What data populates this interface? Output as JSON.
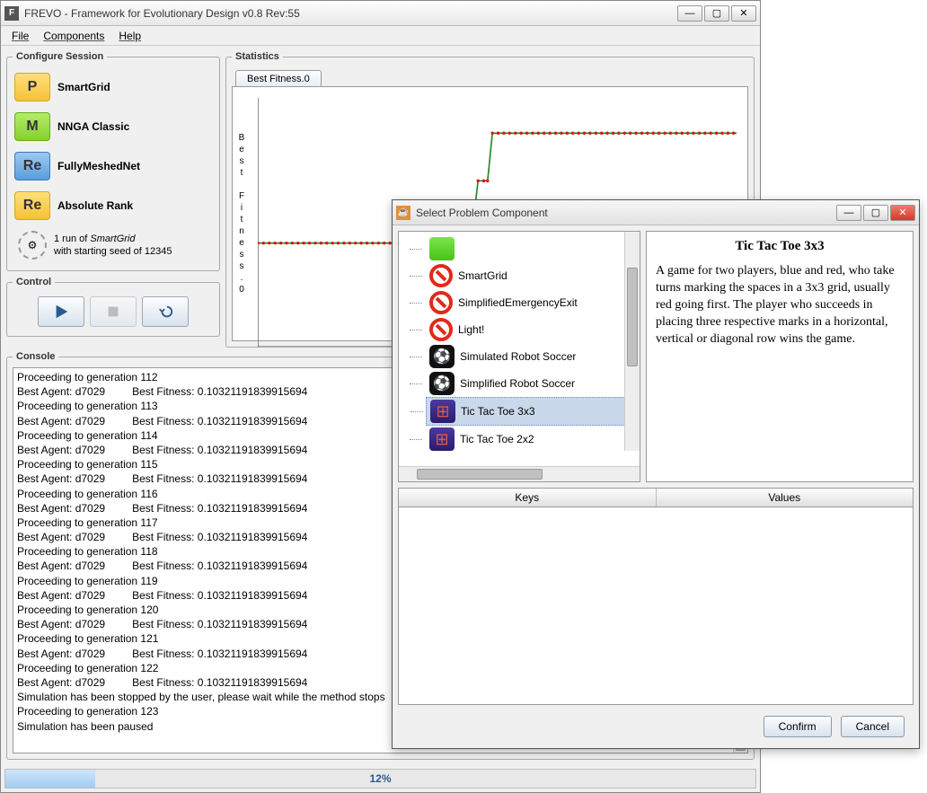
{
  "window": {
    "title": "FREVO - Framework for Evolutionary Design v0.8 Rev:55",
    "menus": [
      "File",
      "Components",
      "Help"
    ]
  },
  "configure": {
    "legend": "Configure Session",
    "items": [
      {
        "icon": "P",
        "cls": "ic-yellow",
        "label": "SmartGrid"
      },
      {
        "icon": "M",
        "cls": "ic-green",
        "label": "NNGA Classic"
      },
      {
        "icon": "Re",
        "cls": "ic-blue",
        "label": "FullyMeshedNet"
      },
      {
        "icon": "Re",
        "cls": "ic-yellow",
        "label": "Absolute Rank"
      }
    ],
    "run_line1_pre": "1 run of ",
    "run_line1_i": "SmartGrid",
    "run_line2": "with starting seed of 12345"
  },
  "control": {
    "legend": "Control"
  },
  "statistics": {
    "legend": "Statistics",
    "tab": "Best Fitness.0",
    "ylabel": "Best Fitness.0"
  },
  "chart_data": {
    "type": "line",
    "title": "Best Fitness.0",
    "xlabel": "",
    "ylabel": "Best Fitness.0",
    "x": [
      0,
      40,
      41,
      45,
      46,
      48,
      49,
      100
    ],
    "values": [
      0.05,
      0.05,
      0.06,
      0.06,
      0.08,
      0.08,
      0.103,
      0.103
    ],
    "ylim": [
      0,
      0.12
    ],
    "xlim": [
      0,
      100
    ]
  },
  "console": {
    "legend": "Console",
    "lines": [
      "Proceeding to generation 112",
      "Best Agent: d7029         Best Fitness: 0.10321191839915694",
      "Proceeding to generation 113",
      "Best Agent: d7029         Best Fitness: 0.10321191839915694",
      "Proceeding to generation 114",
      "Best Agent: d7029         Best Fitness: 0.10321191839915694",
      "Proceeding to generation 115",
      "Best Agent: d7029         Best Fitness: 0.10321191839915694",
      "Proceeding to generation 116",
      "Best Agent: d7029         Best Fitness: 0.10321191839915694",
      "Proceeding to generation 117",
      "Best Agent: d7029         Best Fitness: 0.10321191839915694",
      "Proceeding to generation 118",
      "Best Agent: d7029         Best Fitness: 0.10321191839915694",
      "Proceeding to generation 119",
      "Best Agent: d7029         Best Fitness: 0.10321191839915694",
      "Proceeding to generation 120",
      "Best Agent: d7029         Best Fitness: 0.10321191839915694",
      "Proceeding to generation 121",
      "Best Agent: d7029         Best Fitness: 0.10321191839915694",
      "Proceeding to generation 122",
      "Best Agent: d7029         Best Fitness: 0.10321191839915694",
      "Simulation has been stopped by the user, please wait while the method stops",
      "Proceeding to generation 123",
      "Simulation has been paused"
    ]
  },
  "progress": {
    "pct": "12%"
  },
  "dialog": {
    "title": "Select Problem Component",
    "tree": [
      {
        "icon": "green",
        "label": ""
      },
      {
        "icon": "no",
        "label": "SmartGrid"
      },
      {
        "icon": "no",
        "label": "SimplifiedEmergencyExit"
      },
      {
        "icon": "no",
        "label": "Light!"
      },
      {
        "icon": "ball",
        "label": "Simulated Robot Soccer"
      },
      {
        "icon": "ball",
        "label": "Simplified Robot Soccer"
      },
      {
        "icon": "ttt",
        "label": "Tic Tac Toe 3x3",
        "selected": true
      },
      {
        "icon": "ttt",
        "label": "Tic Tac Toe 2x2"
      }
    ],
    "desc_title": "Tic Tac Toe 3x3",
    "desc_body": "A game for two players, blue and red, who take turns marking the spaces in a 3x3 grid, usually red going first. The player who succeeds in placing three respective marks in a horizontal, vertical or diagonal row wins the game.",
    "kv": {
      "keys": "Keys",
      "values": "Values"
    },
    "buttons": {
      "confirm": "Confirm",
      "cancel": "Cancel"
    }
  }
}
